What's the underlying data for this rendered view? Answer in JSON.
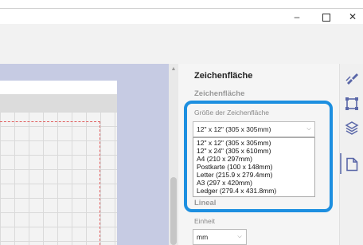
{
  "window": {
    "minimize": "–",
    "maximize": "",
    "close": "✕"
  },
  "panel": {
    "title": "Zeichenfläche",
    "section_title": "Zeichenfläche",
    "size_label": "Größe der Zeichenfläche",
    "size_value": "12\" x 12\" (305 x 305mm)",
    "size_options": [
      "12\" x 12\" (305 x 305mm)",
      "12\" x 24\" (305 x 610mm)",
      "A4 (210 x 297mm)",
      "Postkarte (100 x 148mm)",
      "Letter (215.9 x 279.4mm)",
      "A3 (297 x 420mm)",
      "Ledger (279.4 x 431.8mm)"
    ],
    "lineal_label": "Lineal",
    "einheit_label": "Einheit",
    "unit_value": "mm"
  },
  "sidebar_icons": [
    "brush-icon",
    "crop-icon",
    "layers-icon",
    "page-icon"
  ],
  "colors": {
    "highlight": "#1d8fe0",
    "canvas_bg": "#c6cbe3",
    "dashed_border": "#e06060"
  }
}
